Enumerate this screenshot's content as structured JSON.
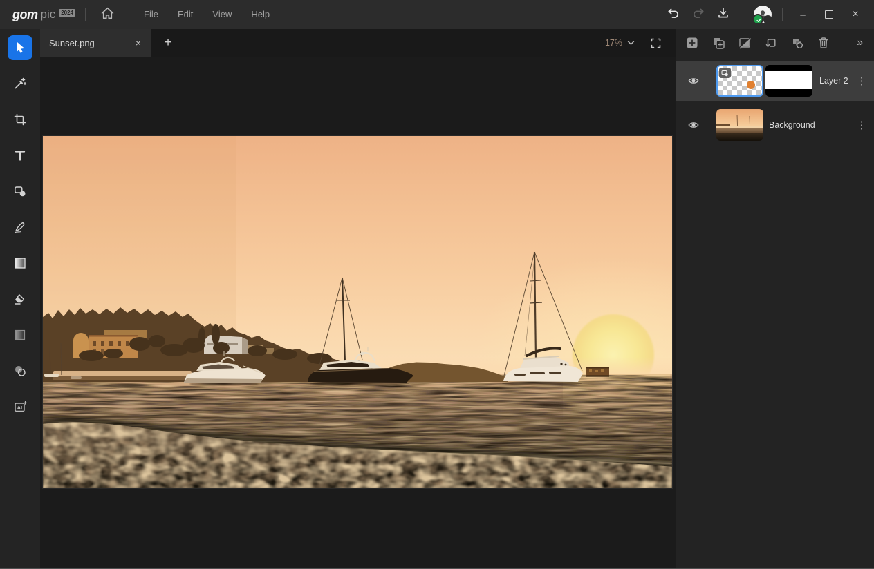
{
  "titlebar": {
    "logo": {
      "text_bold": "gom",
      "text_light": "pic",
      "badge": "2024"
    },
    "menus": [
      {
        "label": "File"
      },
      {
        "label": "Edit"
      },
      {
        "label": "View"
      },
      {
        "label": "Help"
      }
    ]
  },
  "tabbar": {
    "tabs": [
      {
        "title": "Sunset.png"
      }
    ],
    "zoom_level": "17%"
  },
  "toolbar": {
    "tools": [
      {
        "name": "select",
        "active": true
      },
      {
        "name": "ai-wand",
        "active": false
      },
      {
        "name": "crop",
        "active": false
      },
      {
        "name": "text",
        "active": false
      },
      {
        "name": "shape",
        "active": false
      },
      {
        "name": "brush",
        "active": false
      },
      {
        "name": "gradient",
        "active": false
      },
      {
        "name": "eraser",
        "active": false
      },
      {
        "name": "tone",
        "active": false
      },
      {
        "name": "blend",
        "active": false
      },
      {
        "name": "ai-generate",
        "active": false
      }
    ]
  },
  "layers_panel": {
    "layers": [
      {
        "name": "Layer 2",
        "selected": true,
        "visible": true,
        "type": "shape-with-mask"
      },
      {
        "name": "Background",
        "selected": false,
        "visible": true,
        "type": "image"
      }
    ]
  },
  "canvas": {
    "document_title": "Sunset.png",
    "scene_description": "Sunset harbor: peach sky, setting sun, three yachts at anchor, headland with buildings, pebble beach foreground"
  },
  "icons": {
    "close_tab": "×",
    "new_tab": "+",
    "more_vertical": "⋮",
    "collapse_panel": "»",
    "window_minimize": "–",
    "window_close": "×",
    "ai_label": "AI"
  },
  "colors": {
    "accent_blue": "#1974e8",
    "selection_blue": "#4e9af0",
    "sun_orange": "#e08030",
    "status_green": "#1fa34d"
  }
}
